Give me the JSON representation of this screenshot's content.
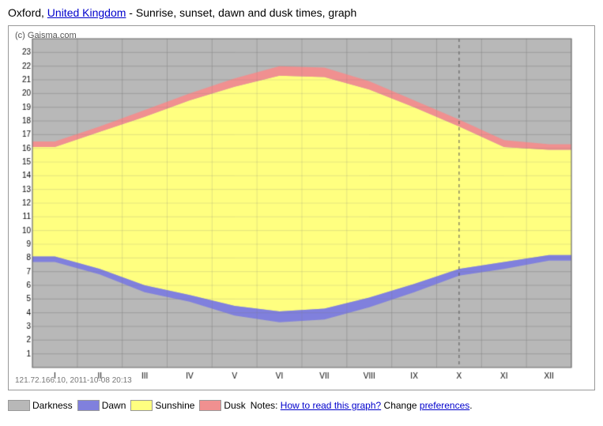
{
  "title": {
    "prefix": "Oxford, ",
    "link_text": "United Kingdom",
    "suffix": " - Sunrise, sunset, dawn and dusk times, graph"
  },
  "watermark": "(c) Gaisma.com",
  "timestamp": "121.72.166.10, 2011-10-08 20:13",
  "y_axis": {
    "max": 23,
    "min": 1
  },
  "x_axis": {
    "labels": [
      "I",
      "II",
      "III",
      "IV",
      "V",
      "VI",
      "VII",
      "VIII",
      "IX",
      "X",
      "XI",
      "XII"
    ]
  },
  "dusk_line": {
    "color": "#e07080"
  },
  "sunshine_color": "#ffff80",
  "dawn_color": "#8080e0",
  "darkness_color": "#c0c0c0",
  "dusk_color": "#f09090",
  "legend": {
    "items": [
      {
        "label": "Darkness",
        "color": "#b8b8b8"
      },
      {
        "label": "Dawn",
        "color": "#8080dd"
      },
      {
        "label": "Sunshine",
        "color": "#ffff80"
      },
      {
        "label": "Dusk",
        "color": "#f09090"
      }
    ],
    "notes_prefix": "Notes: ",
    "notes_link1": "How to read this graph?",
    "notes_text": " Change ",
    "notes_link2": "preferences",
    "notes_suffix": "."
  },
  "dashed_line_x_month": 10
}
